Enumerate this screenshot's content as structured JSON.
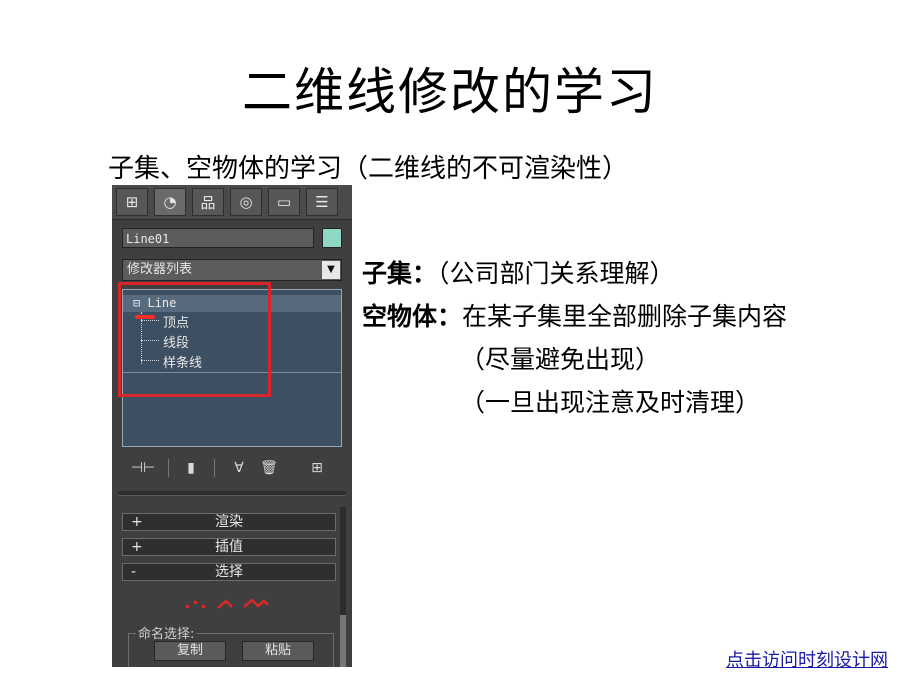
{
  "slide": {
    "title": "二维线修改的学习",
    "subtitle": "子集、空物体的学习（二维线的不可渲染性）",
    "notes": {
      "subset_label": "子集：",
      "subset_text": "（公司部门关系理解）",
      "empty_label": "空物体：",
      "empty_text": "在某子集里全部删除子集内容",
      "avoid": "（尽量避免出现）",
      "cleanup": "（一旦出现注意及时清理）"
    },
    "link_text": "点击访问时刻设计网"
  },
  "panel": {
    "tabs": [
      {
        "icon": "create-icon",
        "glyph": "⊞"
      },
      {
        "icon": "modify-icon",
        "glyph": "◔"
      },
      {
        "icon": "hierarchy-icon",
        "glyph": "品"
      },
      {
        "icon": "motion-icon",
        "glyph": "◎"
      },
      {
        "icon": "display-icon",
        "glyph": "▭"
      },
      {
        "icon": "utilities-icon",
        "glyph": "☰"
      }
    ],
    "object_name": "Line01",
    "object_color": "#8fd8c6",
    "modifier_list": "修改器列表",
    "stack": {
      "root": "Line",
      "root_expander": "⊟",
      "subs": [
        "顶点",
        "线段",
        "样条线"
      ]
    },
    "tools": {
      "pin": "⊣⊢",
      "show_result": "▮",
      "make_unique": "∀",
      "remove_modifier": "🗑",
      "configure": "⊞"
    },
    "rollouts": [
      {
        "sign": "+",
        "label": "渲染"
      },
      {
        "sign": "+",
        "label": "插值"
      },
      {
        "sign": "-",
        "label": "选择"
      }
    ],
    "named_selection": {
      "label": "命名选择:",
      "copy": "复制",
      "paste": "粘贴"
    }
  },
  "colors": {
    "highlight_box": "#d8262a",
    "stack_bg": "#3d4f63",
    "link": "#1a1aa8"
  }
}
